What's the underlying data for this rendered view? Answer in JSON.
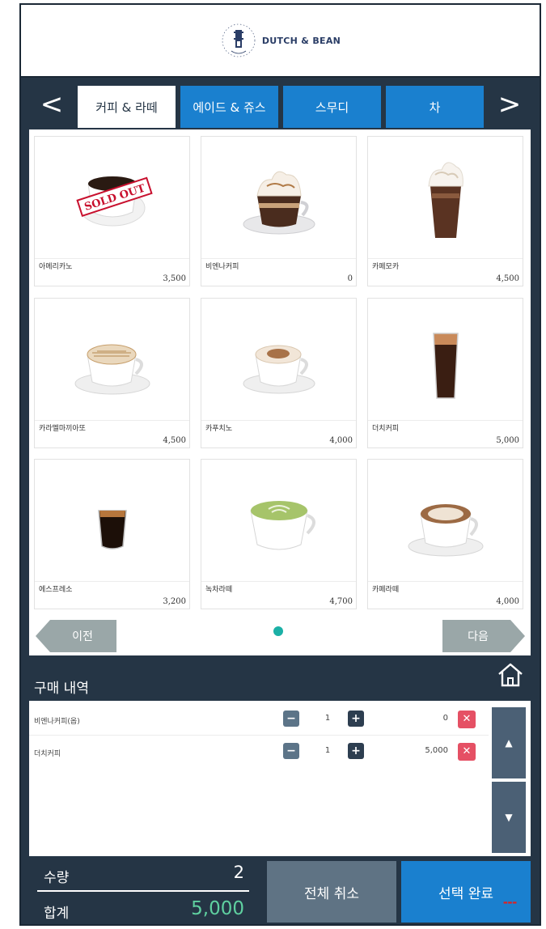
{
  "brand": {
    "name": "DUTCH & BEAN",
    "seal_text": "DUTCH & BEAN"
  },
  "tabs": {
    "prev_arrow": "<",
    "next_arrow": ">",
    "items": [
      {
        "label": "커피 & 라떼",
        "active": true
      },
      {
        "label": "에이드 & 쥬스",
        "active": false
      },
      {
        "label": "스무디",
        "active": false
      },
      {
        "label": "차",
        "active": false
      }
    ]
  },
  "products": [
    {
      "name": "아메리카노",
      "price": "3,500",
      "sold_out": true,
      "badge": "SOLD OUT",
      "image": "americano-cup"
    },
    {
      "name": "비엔나커피",
      "price": "0",
      "sold_out": false,
      "image": "vienna-coffee"
    },
    {
      "name": "카페모카",
      "price": "4,500",
      "sold_out": false,
      "image": "iced-mocha"
    },
    {
      "name": "카라멜마끼아또",
      "price": "4,500",
      "sold_out": false,
      "image": "caramel-macchiato"
    },
    {
      "name": "카푸치노",
      "price": "4,000",
      "sold_out": false,
      "image": "cappuccino"
    },
    {
      "name": "더치커피",
      "price": "5,000",
      "sold_out": false,
      "image": "dutch-coffee"
    },
    {
      "name": "에스프레소",
      "price": "3,200",
      "sold_out": false,
      "image": "espresso"
    },
    {
      "name": "녹차라떼",
      "price": "4,700",
      "sold_out": false,
      "image": "green-tea-latte"
    },
    {
      "name": "카페라떼",
      "price": "4,000",
      "sold_out": false,
      "image": "cafe-latte"
    }
  ],
  "pager": {
    "prev_label": "이전",
    "next_label": "다음",
    "current_page": 1,
    "total_pages": 1
  },
  "history": {
    "title": "구매 내역",
    "items": [
      {
        "name": "비엔나커피(옵)",
        "qty": "1",
        "price": "0"
      },
      {
        "name": "더치커피",
        "qty": "1",
        "price": "5,000"
      }
    ],
    "minus": "−",
    "plus": "+",
    "remove": "✕",
    "scroll_up": "▲",
    "scroll_down": "▼"
  },
  "summary": {
    "qty_label": "수량",
    "qty_value": "2",
    "total_label": "합계",
    "total_value": "5,000"
  },
  "actions": {
    "cancel_all": "전체 취소",
    "complete": "선택 완료"
  },
  "colors": {
    "frame": "#253545",
    "tab_blue": "#1a80cf",
    "cancel_gray": "#5f7384",
    "total_green": "#5fd0a0",
    "remove_red": "#e55064",
    "sold_out_red": "#c8102e",
    "pager_dot": "#1bb0a6"
  }
}
